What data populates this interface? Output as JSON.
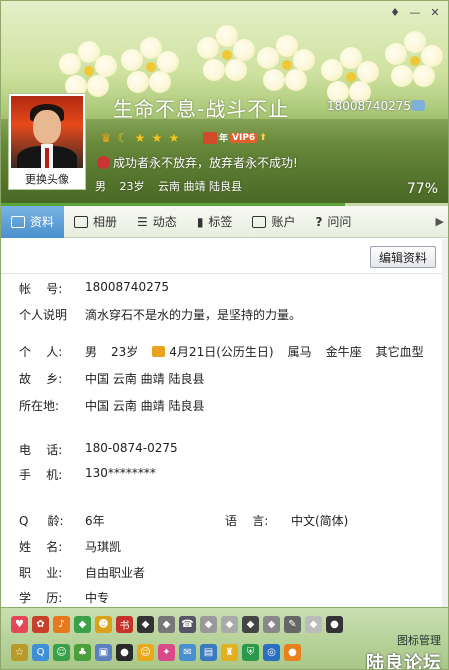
{
  "header": {
    "nickname": "生命不息-战斗不止",
    "qq_number": "18008740275",
    "change_photo": "更换头像",
    "vip_label": "VIP6",
    "vip_prefix": "年",
    "signature": "成功者永不放弃，放弃者永不成功!",
    "gender": "男",
    "age": "23岁",
    "location": "云南 曲靖 陆良县",
    "completion": "77%",
    "completion_value": 0.77
  },
  "tabs": [
    {
      "label": "资料",
      "icon": "profile-card-icon"
    },
    {
      "label": "相册",
      "icon": "photo-album-icon"
    },
    {
      "label": "动态",
      "icon": "feed-list-icon"
    },
    {
      "label": "标签",
      "icon": "bookmark-tag-icon"
    },
    {
      "label": "账户",
      "icon": "wallet-icon"
    },
    {
      "label": "问问",
      "icon": "question-icon"
    }
  ],
  "edit_button": "编辑资料",
  "profile": {
    "account_label": "帐    号:",
    "account_value": "18008740275",
    "desc_label": "个人说明",
    "desc_value": "滴水穿石不是水的力量，是坚持的力量。",
    "personal_label": "个    人:",
    "personal_gender": "男",
    "personal_age": "23岁",
    "personal_birthday": "4月21日(公历生日)",
    "personal_zodiac": "属马",
    "personal_constellation": "金牛座",
    "personal_blood": "其它血型",
    "hometown_label": "故    乡:",
    "hometown_value": "中国 云南 曲靖 陆良县",
    "location_label": "所在地:",
    "location_value": "中国 云南 曲靖 陆良县",
    "phone_label": "电    话:",
    "phone_value": "180-0874-0275",
    "mobile_label": "手    机:",
    "mobile_value": "130********",
    "qage_label": "Q     龄:",
    "qage_value": "6年",
    "lang_label": "语    言:",
    "lang_value": "中文(简体)",
    "name_label": "姓    名:",
    "name_value": "马琪凯",
    "job_label": "职    业:",
    "job_value": "自由职业者",
    "edu_label": "学    历:",
    "edu_value": "中专"
  },
  "footer": {
    "icon_manage": "图标管理",
    "watermark": "陆良论坛"
  },
  "colors": {
    "active_tab": "#4a8fce",
    "header_green": "#7fa44b",
    "progress_fill": "#5ba43a"
  }
}
